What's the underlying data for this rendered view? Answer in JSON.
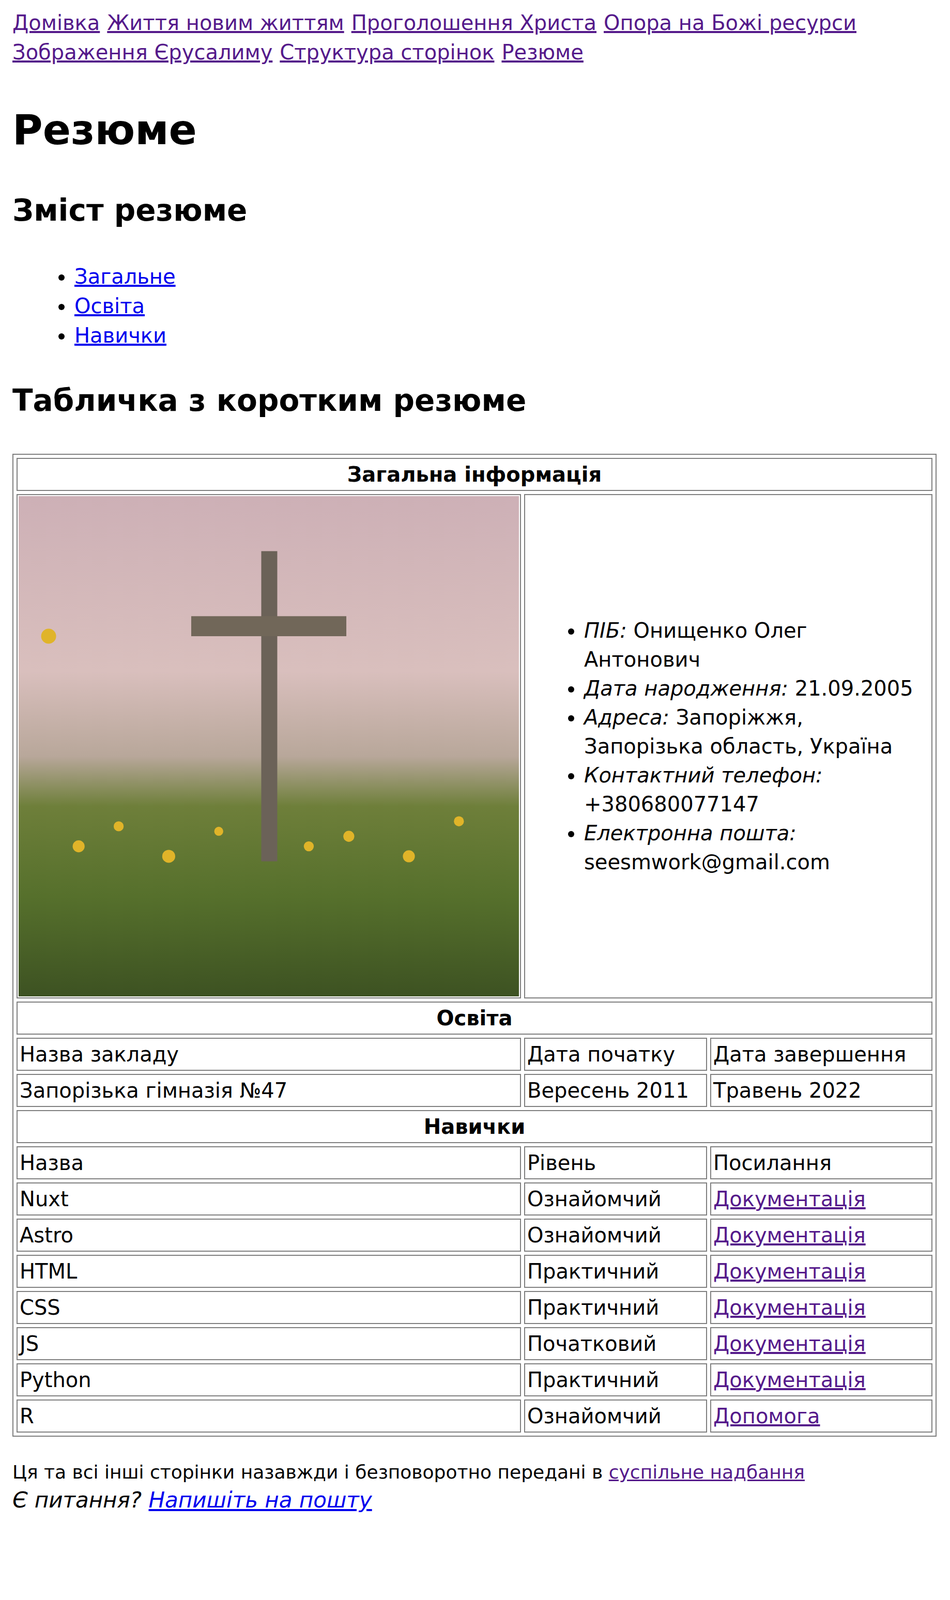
{
  "nav": [
    {
      "label": "Домівка",
      "visited": true
    },
    {
      "label": "Життя новим життям",
      "visited": true
    },
    {
      "label": "Проголошення Христа",
      "visited": true
    },
    {
      "label": "Опора на Божі ресурси",
      "visited": true
    },
    {
      "label": "Зображення Єрусалиму",
      "visited": true
    },
    {
      "label": "Структура сторінок",
      "visited": true
    },
    {
      "label": "Резюме",
      "visited": true
    }
  ],
  "title": "Резюме",
  "toc": {
    "heading": "Зміст резюме",
    "items": [
      {
        "label": "Загальне",
        "visited": false
      },
      {
        "label": "Освіта",
        "visited": false
      },
      {
        "label": "Навички",
        "visited": false
      }
    ]
  },
  "table": {
    "heading": "Табличка з коротким резюме",
    "general": {
      "heading": "Загальна інформація",
      "fields": [
        {
          "label": "ПІБ:",
          "value": "Онищенко Олег Антонович"
        },
        {
          "label": "Дата народження:",
          "value": "21.09.2005"
        },
        {
          "label": "Адреса:",
          "value": "Запоріжжя, Запорізька область, Україна"
        },
        {
          "label": "Контактний телефон:",
          "value": "+380680077147"
        },
        {
          "label": "Електронна пошта:",
          "value": "seesmwork@gmail.com"
        }
      ]
    },
    "education": {
      "heading": "Освіта",
      "columns": [
        "Назва закладу",
        "Дата початку",
        "Дата завершення"
      ],
      "rows": [
        [
          "Запорізька гімназія №47",
          "Вересень 2011",
          "Травень 2022"
        ]
      ]
    },
    "skills": {
      "heading": "Навички",
      "columns": [
        "Назва",
        "Рівень",
        "Посилання"
      ],
      "rows": [
        {
          "name": "Nuxt",
          "level": "Ознайомчий",
          "link": {
            "label": "Документація",
            "visited": true
          }
        },
        {
          "name": "Astro",
          "level": "Ознайомчий",
          "link": {
            "label": "Документація",
            "visited": true
          }
        },
        {
          "name": "HTML",
          "level": "Практичний",
          "link": {
            "label": "Документація",
            "visited": true
          }
        },
        {
          "name": "CSS",
          "level": "Практичний",
          "link": {
            "label": "Документація",
            "visited": true
          }
        },
        {
          "name": "JS",
          "level": "Початковий",
          "link": {
            "label": "Документація",
            "visited": true
          }
        },
        {
          "name": "Python",
          "level": "Практичний",
          "link": {
            "label": "Документація",
            "visited": true
          }
        },
        {
          "name": "R",
          "level": "Ознайомчий",
          "link": {
            "label": "Допомога",
            "visited": true
          }
        }
      ]
    }
  },
  "footer": {
    "license_text": "Ця та всі інші сторінки назавжди і безповоротно передані в",
    "license_link": {
      "label": "суспільне надбання",
      "visited": true
    },
    "question": "Є питання?",
    "mail_link": {
      "label": "Напишіть на пошту",
      "visited": false
    }
  }
}
